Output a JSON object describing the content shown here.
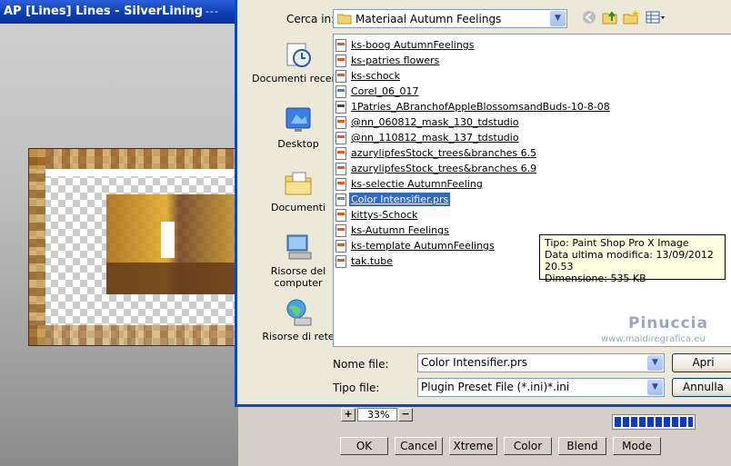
{
  "background_window": {
    "title": "AP [Lines]  Lines - SilverLining",
    "title_extra": "---",
    "zoom_minus_label": "−",
    "zoom_plus_label": "+",
    "zoom_value": "33%",
    "progress_fraction": 1.0,
    "buttons": [
      "OK",
      "Cancel",
      "Xtreme",
      "Color",
      "Blend",
      "Mode"
    ]
  },
  "dialog": {
    "lookin_label": "Cerca in:",
    "lookin_value": "Materiaal Autumn Feelings",
    "toolbar_icons": [
      "back-icon",
      "up-folder-icon",
      "new-folder-icon",
      "view-menu-icon"
    ],
    "places": [
      {
        "label": "Documenti recenti",
        "icon": "recent-documents-icon"
      },
      {
        "label": "Desktop",
        "icon": "desktop-icon"
      },
      {
        "label": "Documenti",
        "icon": "documents-icon"
      },
      {
        "label": "Risorse del computer",
        "icon": "my-computer-icon"
      },
      {
        "label": "Risorse di rete",
        "icon": "network-icon"
      }
    ],
    "files": [
      {
        "name": "ks-boog AutumnFeelings",
        "icon": "psp-image-icon",
        "selected": false
      },
      {
        "name": "ks-patries flowers",
        "icon": "psp-image-icon",
        "selected": false
      },
      {
        "name": "ks-schock",
        "icon": "psp-image-icon",
        "selected": false
      },
      {
        "name": "Corel_06_017",
        "icon": "image-file-icon",
        "selected": false
      },
      {
        "name": "1Patries_ABranchofAppleBlossomsandBuds-10-8-08",
        "icon": "camera-file-icon",
        "selected": false
      },
      {
        "name": "@nn_060812_mask_130_tdstudio",
        "icon": "psp-image-icon",
        "selected": false
      },
      {
        "name": "@nn_110812_mask_137_tdstudio",
        "icon": "psp-image-icon",
        "selected": false
      },
      {
        "name": "azurylipfesStock_trees&branches 6.5",
        "icon": "psp-image-icon",
        "selected": false
      },
      {
        "name": "azurylipfesStock_trees&branches 6.9",
        "icon": "psp-image-icon",
        "selected": false
      },
      {
        "name": "ks-selectie AutumnFeeling",
        "icon": "psp-image-icon",
        "selected": false
      },
      {
        "name": "Color Intensifier.prs",
        "icon": "preset-file-icon",
        "selected": true
      },
      {
        "name": "kittys-Schock",
        "icon": "psp-image-icon",
        "selected": false
      },
      {
        "name": "ks-Autumn Feelings",
        "icon": "psp-image-icon",
        "selected": false
      },
      {
        "name": "ks-template AutumnFeelings",
        "icon": "psp-image-icon",
        "selected": false
      },
      {
        "name": "tak.tube",
        "icon": "psp-image-icon",
        "selected": false
      }
    ],
    "tooltip": {
      "line1": "Tipo: Paint Shop Pro X Image",
      "line2": "Data ultima modifica: 13/09/2012 20.53",
      "line3": "Dimensione: 535 KB"
    },
    "watermark": {
      "line1": "Pinuccia",
      "line2": "www.maidiregrafica.eu"
    },
    "filename_label": "Nome file:",
    "filename_value": "Color Intensifier.prs",
    "filetype_label": "Tipo file:",
    "filetype_value": "Plugin Preset File (*.ini)*.ini",
    "open_button": "Apri",
    "cancel_button": "Annulla"
  },
  "colors": {
    "titlebar": "#0a3bb0",
    "selection": "#316ac5",
    "tooltip_bg": "#ffffe1"
  }
}
